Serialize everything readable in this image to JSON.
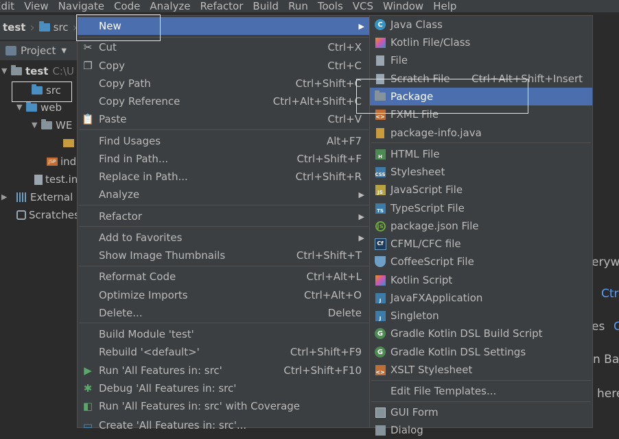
{
  "menubar": [
    "Edit",
    "View",
    "Navigate",
    "Code",
    "Analyze",
    "Refactor",
    "Build",
    "Run",
    "Tools",
    "VCS",
    "Window",
    "Help"
  ],
  "breadcrumb": [
    "test",
    "src"
  ],
  "project_panel": {
    "title": "Project",
    "tree": {
      "test": "test",
      "test_path": "C:\\U",
      "src": "src",
      "web": "web",
      "web_inf": "WE",
      "index": "ind",
      "test_iml": "test.in",
      "external": "External L",
      "scratches": "Scratches"
    }
  },
  "context_menu": [
    {
      "label": "New",
      "shortcut": "",
      "submenu": true,
      "selected": true,
      "icon": ""
    },
    {
      "label": "Cut",
      "shortcut": "Ctrl+X",
      "icon": "scissors-icon"
    },
    {
      "label": "Copy",
      "shortcut": "Ctrl+C",
      "icon": "copy-icon"
    },
    {
      "label": "Copy Path",
      "shortcut": "Ctrl+Shift+C"
    },
    {
      "label": "Copy Reference",
      "shortcut": "Ctrl+Alt+Shift+C"
    },
    {
      "label": "Paste",
      "shortcut": "Ctrl+V",
      "icon": "paste-icon"
    },
    {
      "label": "Find Usages",
      "shortcut": "Alt+F7"
    },
    {
      "label": "Find in Path...",
      "shortcut": "Ctrl+Shift+F"
    },
    {
      "label": "Replace in Path...",
      "shortcut": "Ctrl+Shift+R"
    },
    {
      "label": "Analyze",
      "submenu": true
    },
    {
      "label": "Refactor",
      "submenu": true
    },
    {
      "label": "Add to Favorites",
      "submenu": true
    },
    {
      "label": "Show Image Thumbnails",
      "shortcut": "Ctrl+Shift+T"
    },
    {
      "label": "Reformat Code",
      "shortcut": "Ctrl+Alt+L"
    },
    {
      "label": "Optimize Imports",
      "shortcut": "Ctrl+Alt+O"
    },
    {
      "label": "Delete...",
      "shortcut": "Delete"
    },
    {
      "label": "Build Module 'test'"
    },
    {
      "label": "Rebuild '<default>'",
      "shortcut": "Ctrl+Shift+F9"
    },
    {
      "label": "Run 'All Features in: src'",
      "shortcut": "Ctrl+Shift+F10",
      "icon": "run-icon"
    },
    {
      "label": "Debug 'All Features in: src'",
      "icon": "debug-icon"
    },
    {
      "label": "Run 'All Features in: src' with Coverage",
      "icon": "coverage-icon"
    },
    {
      "label": "Create 'All Features in: src'...",
      "icon": "create-config-icon"
    }
  ],
  "submenu": [
    {
      "label": "Java Class",
      "icon": "java-class-icon"
    },
    {
      "label": "Kotlin File/Class",
      "icon": "kotlin-icon"
    },
    {
      "label": "File",
      "icon": "file-icon"
    },
    {
      "label": "Scratch File",
      "shortcut": "Ctrl+Alt+Shift+Insert",
      "icon": "scratch-file-icon"
    },
    {
      "label": "Package",
      "selected": true,
      "icon": "package-icon"
    },
    {
      "label": "FXML File",
      "icon": "fxml-icon"
    },
    {
      "label": "package-info.java",
      "icon": "package-info-icon"
    },
    {
      "label": "HTML File",
      "icon": "html-icon"
    },
    {
      "label": "Stylesheet",
      "icon": "css-icon"
    },
    {
      "label": "JavaScript File",
      "icon": "javascript-icon"
    },
    {
      "label": "TypeScript File",
      "icon": "typescript-icon"
    },
    {
      "label": "package.json File",
      "icon": "nodejs-icon"
    },
    {
      "label": "CFML/CFC file",
      "icon": "cfml-icon"
    },
    {
      "label": "CoffeeScript File",
      "icon": "coffeescript-icon"
    },
    {
      "label": "Kotlin Script",
      "icon": "kotlin-script-icon"
    },
    {
      "label": "JavaFXApplication",
      "icon": "javafx-icon"
    },
    {
      "label": "Singleton",
      "icon": "singleton-icon"
    },
    {
      "label": "Gradle Kotlin DSL Build Script",
      "icon": "gradle-icon"
    },
    {
      "label": "Gradle Kotlin DSL Settings",
      "icon": "gradle-settings-icon"
    },
    {
      "label": "XSLT Stylesheet",
      "icon": "xslt-icon"
    },
    {
      "label": "Edit File Templates..."
    },
    {
      "label": "GUI Form",
      "icon": "gui-form-icon"
    },
    {
      "label": "Dialog",
      "icon": "dialog-icon"
    }
  ],
  "editor_fragments": [
    "eryw",
    "Ctr",
    "es",
    "C",
    "n Ba",
    "here"
  ],
  "colors": {
    "selection": "#4b6eaf",
    "menu_bg": "#3c3f41",
    "editor_bg": "#2b2b2b",
    "link": "#589df6"
  }
}
